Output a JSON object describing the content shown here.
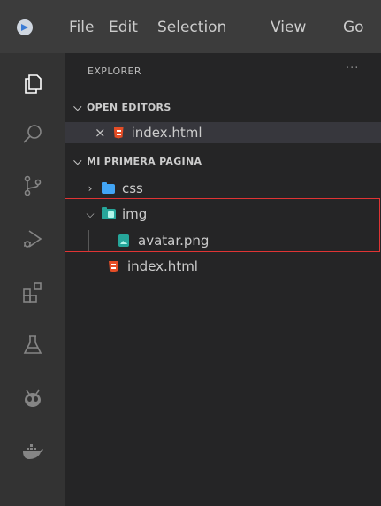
{
  "menu": {
    "items": [
      "File",
      "Edit",
      "Selection",
      "View",
      "Go"
    ]
  },
  "activity_bar": {
    "icons": [
      "files-icon",
      "search-icon",
      "source-control-icon",
      "run-debug-icon",
      "extensions-icon",
      "testing-icon",
      "platformio-icon",
      "docker-icon"
    ]
  },
  "explorer": {
    "title": "EXPLORER",
    "more": "···",
    "open_editors": {
      "label": "OPEN EDITORS",
      "items": [
        {
          "close": "×",
          "name": "index.html"
        }
      ]
    },
    "workspace": {
      "label": "MI PRIMERA PAGINA",
      "css_folder": "css",
      "img_folder": "img",
      "img_child": "avatar.png",
      "index_file": "index.html"
    }
  },
  "colors": {
    "highlight_border": "#e03434",
    "html_icon": "#e44d26",
    "css_folder": "#42a5f5",
    "img_folder": "#26a69a"
  }
}
